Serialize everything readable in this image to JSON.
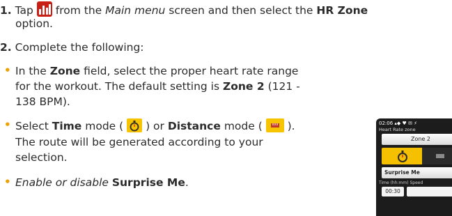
{
  "step1": {
    "num": "1.",
    "text_a": "Tap",
    "icon": "chart-bars-icon",
    "text_b": "from the",
    "main_menu": "Main menu",
    "text_c": "screen and then select the",
    "hr_zone": "HR Zone",
    "text_d": "option."
  },
  "step2": {
    "num": "2.",
    "text": "Complete the following:"
  },
  "bullet1": {
    "text_a": "In the",
    "zone": "Zone",
    "text_b": "field, select the proper heart rate range",
    "text_c": "for the workout. The default setting is",
    "zone2": "Zone 2",
    "text_d": "(121 -",
    "text_e": "138 BPM)."
  },
  "bullet2": {
    "text_a": "Select",
    "time": "Time",
    "text_b": "mode (",
    "text_c": ") or",
    "distance": "Distance",
    "text_d": "mode (",
    "text_e": ").",
    "text_f": "The route will be generated according to your",
    "text_g": "selection."
  },
  "bullet3": {
    "text_a": "Enable or disable",
    "surprise": "Surprise Me",
    "text_b": "."
  },
  "icons": {
    "timer": "stopwatch-icon",
    "distance": "ruler-icon"
  },
  "phone": {
    "status": "02:06 ▴◆ ♥ ✉ ⚡",
    "label": "Heart Rate zone",
    "zone": "Zone 2",
    "surprise": "Surprise Me",
    "sub": "Time (hh:mm)   Speed",
    "time": "00:30"
  },
  "colors": {
    "accent": "#f5c000",
    "bullet": "#f0a000",
    "icon_red": "#c81e14"
  }
}
